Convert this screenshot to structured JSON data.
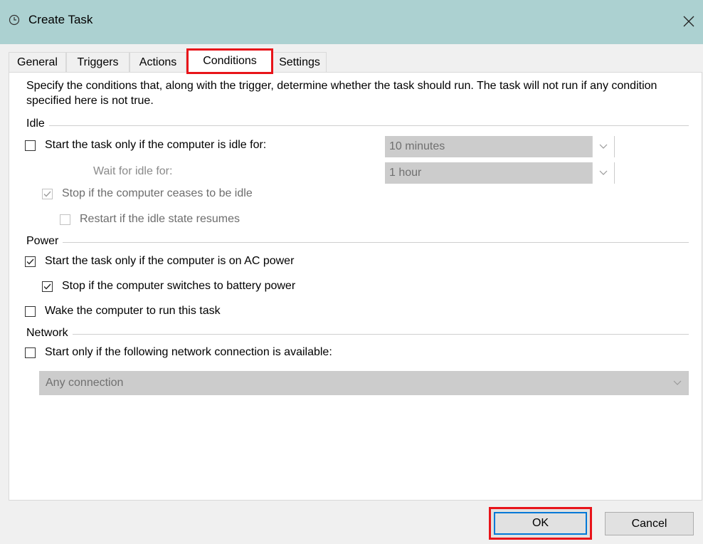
{
  "window": {
    "title": "Create Task",
    "accent": "#acd1d1",
    "highlight_color": "#e8141a"
  },
  "tabs": [
    {
      "label": "General"
    },
    {
      "label": "Triggers"
    },
    {
      "label": "Actions"
    },
    {
      "label": "Conditions",
      "active": true
    },
    {
      "label": "Settings"
    }
  ],
  "description": "Specify the conditions that, along with the trigger, determine whether the task should run.  The task will not run  if any condition specified here is not true.",
  "idle": {
    "group_label": "Idle",
    "start_only_if_idle": {
      "label": "Start the task only if the computer is idle for:",
      "checked": false
    },
    "idle_for": {
      "value": "10 minutes"
    },
    "wait_for_idle": {
      "label": "Wait for idle for:",
      "value": "1 hour"
    },
    "stop_if_ceases": {
      "label": "Stop if the computer ceases to be idle",
      "checked": true,
      "enabled": false
    },
    "restart_if_resumes": {
      "label": "Restart if the idle state resumes",
      "checked": false,
      "enabled": false
    }
  },
  "power": {
    "group_label": "Power",
    "ac_power": {
      "label": "Start the task only if the computer is on AC power",
      "checked": true
    },
    "battery_stop": {
      "label": "Stop if the computer switches to battery power",
      "checked": true
    },
    "wake": {
      "label": "Wake the computer to run this task",
      "checked": false
    }
  },
  "network": {
    "group_label": "Network",
    "start_if_network": {
      "label": "Start only if the following network connection is available:",
      "checked": false
    },
    "connection": {
      "value": "Any connection"
    }
  },
  "buttons": {
    "ok": "OK",
    "cancel": "Cancel"
  }
}
